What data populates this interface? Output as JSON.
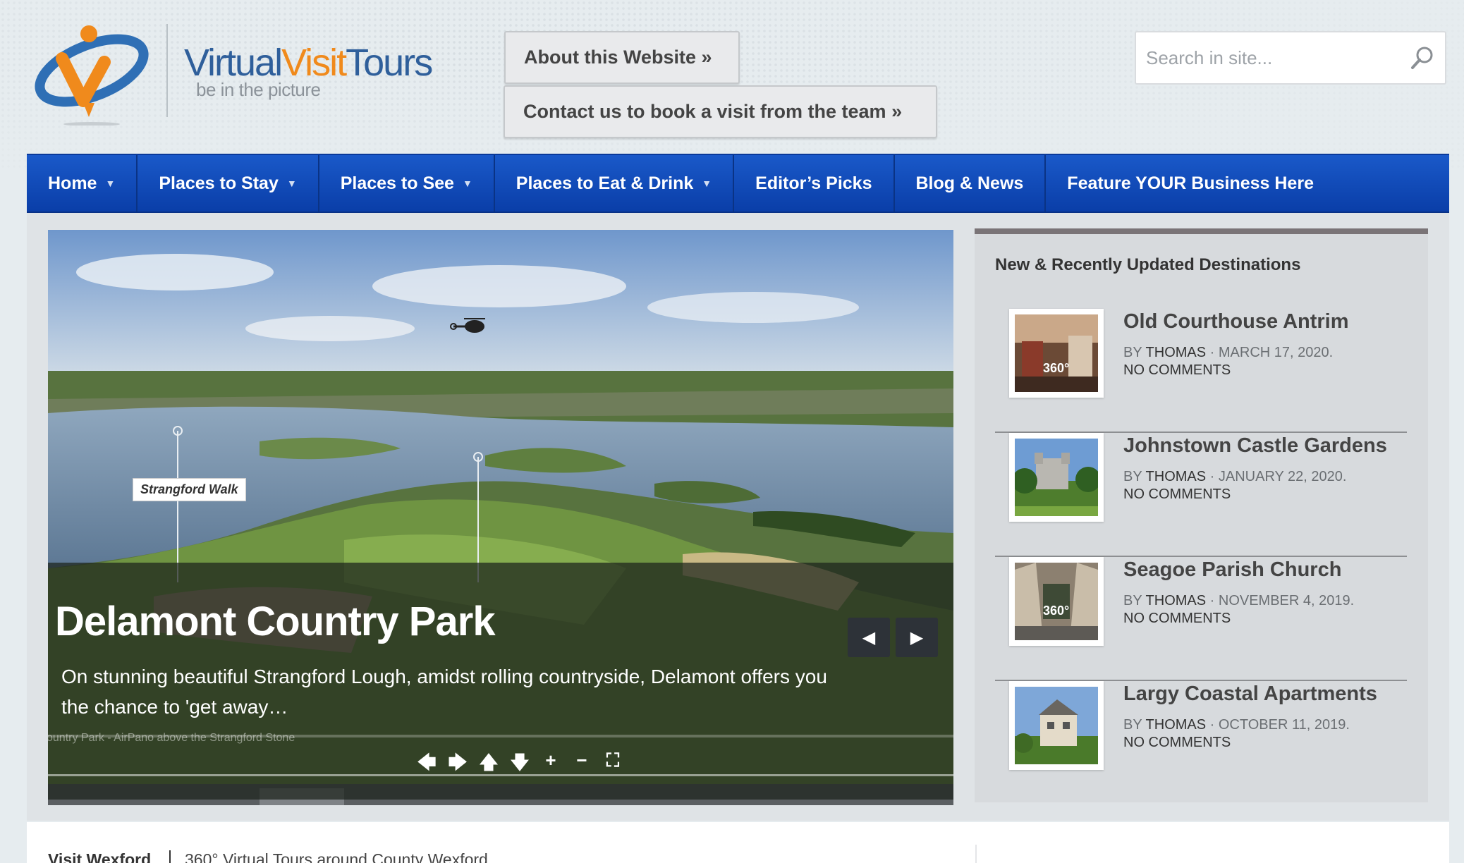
{
  "site": {
    "logo_text_part1": "Virtual",
    "logo_text_part2": "Visit",
    "logo_text_part3": "Tours",
    "tagline": "be in the picture",
    "brand_blue": "#2f5f9b",
    "brand_orange": "#f08a1c"
  },
  "header": {
    "about_button": "About this Website »",
    "contact_button": "Contact us to book a visit from the team »",
    "search_placeholder": "Search in site...",
    "search_icon": "search-icon"
  },
  "nav": {
    "items": [
      {
        "label": "Home",
        "has_dropdown": true
      },
      {
        "label": "Places to Stay",
        "has_dropdown": true
      },
      {
        "label": "Places to See",
        "has_dropdown": true
      },
      {
        "label": "Places to Eat & Drink",
        "has_dropdown": true
      },
      {
        "label": "Editor’s Picks",
        "has_dropdown": false
      },
      {
        "label": "Blog & News",
        "has_dropdown": false
      },
      {
        "label": "Feature YOUR Business Here",
        "has_dropdown": false
      }
    ],
    "caret": "▼",
    "nav_color": "#1a59c9"
  },
  "slider": {
    "title": "Delamont Country Park",
    "text": "On stunning beautiful Strangford Lough, amidst rolling countryside, Delamont offers you the chance to 'get away…",
    "pano_label": "ountry Park - AirPano above the Strangford Stone",
    "hotspot_label": "Strangford Walk",
    "controls": [
      "🡄",
      "🡆",
      "🡅",
      "🡇",
      "+",
      "−",
      "⛶"
    ],
    "prev_icon": "◀",
    "next_icon": "▶"
  },
  "sidebar": {
    "title": "New & Recently Updated Destinations",
    "items": [
      {
        "title": "Old Courthouse Antrim",
        "by": "BY",
        "author": "THOMAS",
        "date": "· MARCH 17, 2020.",
        "comments": "NO COMMENTS",
        "badge": "360°"
      },
      {
        "title": "Johnstown Castle Gardens",
        "by": "BY",
        "author": "THOMAS",
        "date": "· JANUARY 22, 2020.",
        "comments": "NO COMMENTS",
        "badge": ""
      },
      {
        "title": "Seagoe Parish Church",
        "by": "BY",
        "author": "THOMAS",
        "date": "· NOVEMBER 4, 2019.",
        "comments": "NO COMMENTS",
        "badge": "360°"
      },
      {
        "title": "Largy Coastal Apartments",
        "by": "BY",
        "author": "THOMAS",
        "date": "· OCTOBER 11, 2019.",
        "comments": "NO COMMENTS",
        "badge": ""
      }
    ]
  },
  "footer_strip": {
    "title": "Visit Wexford",
    "subtitle": "360° Virtual Tours around County Wexford"
  }
}
